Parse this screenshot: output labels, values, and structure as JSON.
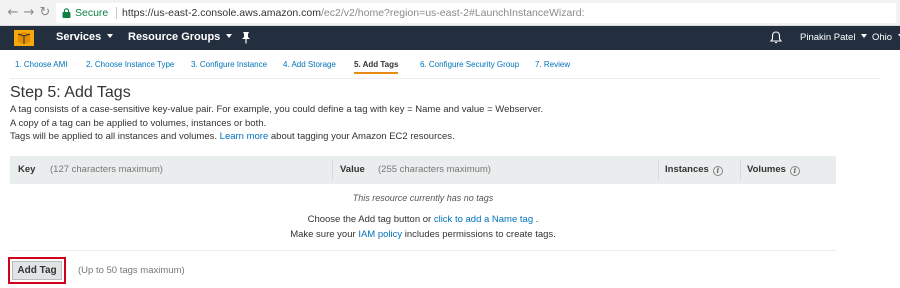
{
  "browser": {
    "secure_label": "Secure",
    "url_prefix": "https://",
    "url_domain": "us-east-2.console.aws.amazon.com",
    "url_path": "/ec2/v2/home?region=us-east-2#LaunchInstanceWizard:"
  },
  "nav": {
    "services_label": "Services",
    "resource_groups_label": "Resource Groups",
    "user_label": "Pinakin Patel",
    "region_label": "Ohio",
    "icons": {
      "logo": "aws-cube-icon",
      "pin": "pin-icon",
      "bell": "bell-icon",
      "caret": "caret-down-icon"
    },
    "bar_color": "#232f3e"
  },
  "wizard": {
    "steps": [
      {
        "label": "1. Choose AMI",
        "active": false
      },
      {
        "label": "2. Choose Instance Type",
        "active": false
      },
      {
        "label": "3. Configure Instance",
        "active": false
      },
      {
        "label": "4. Add Storage",
        "active": false
      },
      {
        "label": "5. Add Tags",
        "active": true
      },
      {
        "label": "6. Configure Security Group",
        "active": false
      },
      {
        "label": "7. Review",
        "active": false
      }
    ],
    "active_color": "#e88a13",
    "link_color": "#0073bb"
  },
  "page": {
    "title": "Step 5: Add Tags",
    "desc_line1": "A tag consists of a case-sensitive key-value pair. For example, you could define a tag with key = Name and value = Webserver.",
    "desc_line2": "A copy of a tag can be applied to volumes, instances or both.",
    "desc_line3_pre": "Tags will be applied to all instances and volumes.",
    "desc_line3_link": "Learn more",
    "desc_line3_post": "about tagging your Amazon EC2 resources."
  },
  "table": {
    "key_label": "Key",
    "key_hint": "(127 characters maximum)",
    "value_label": "Value",
    "value_hint": "(255 characters maximum)",
    "instances_label": "Instances",
    "volumes_label": "Volumes",
    "info_icon": "info-icon",
    "empty_message": "This resource currently has no tags",
    "hint1_pre": "Choose the Add tag button or",
    "hint1_link": "click to add a Name tag",
    "hint1_post": ".",
    "hint2_pre": "Make sure your",
    "hint2_link": "IAM policy",
    "hint2_post": "includes permissions to create tags."
  },
  "actions": {
    "add_tag_label": "Add Tag",
    "add_tag_note": "(Up to 50 tags maximum)",
    "highlight_color": "#d0021b"
  }
}
